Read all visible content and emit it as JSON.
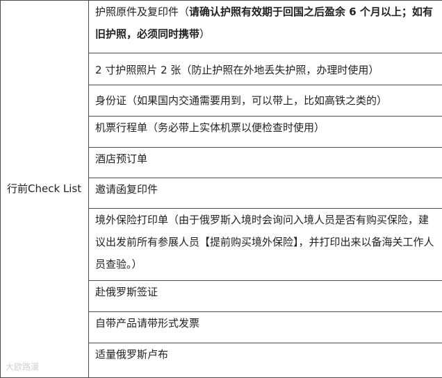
{
  "table": {
    "label": "行前Check List",
    "items": [
      {
        "text": "护照原件及复印件（",
        "bold": "请确认护照有效期于回国之后盈余 6 个月以上；如有旧护照，必须同时携带",
        "tail": "）"
      },
      {
        "text": "2 寸护照照片 2 张（防止护照在外地丢失护照，办理时使用）"
      },
      {
        "text": "身份证（如果国内交通需要用到，可以带上，比如高铁之类的）"
      },
      {
        "text": "机票行程单（务必带上实体机票以便检查时使用）"
      },
      {
        "text": "酒店预订单"
      },
      {
        "text": "邀请函复印件"
      },
      {
        "text": "境外保险打印单（由于俄罗斯入境时会询问入境人员是否有购买保险，建议出发前所有参展人员【提前购买境外保险】，并打印出来以备海关工作人员查验。）"
      },
      {
        "text": "赴俄罗斯签证"
      },
      {
        "text": "自带产品请带形式发票"
      },
      {
        "text": "适量俄罗斯卢布"
      }
    ]
  },
  "watermark": {
    "text": "大欧路漫"
  }
}
